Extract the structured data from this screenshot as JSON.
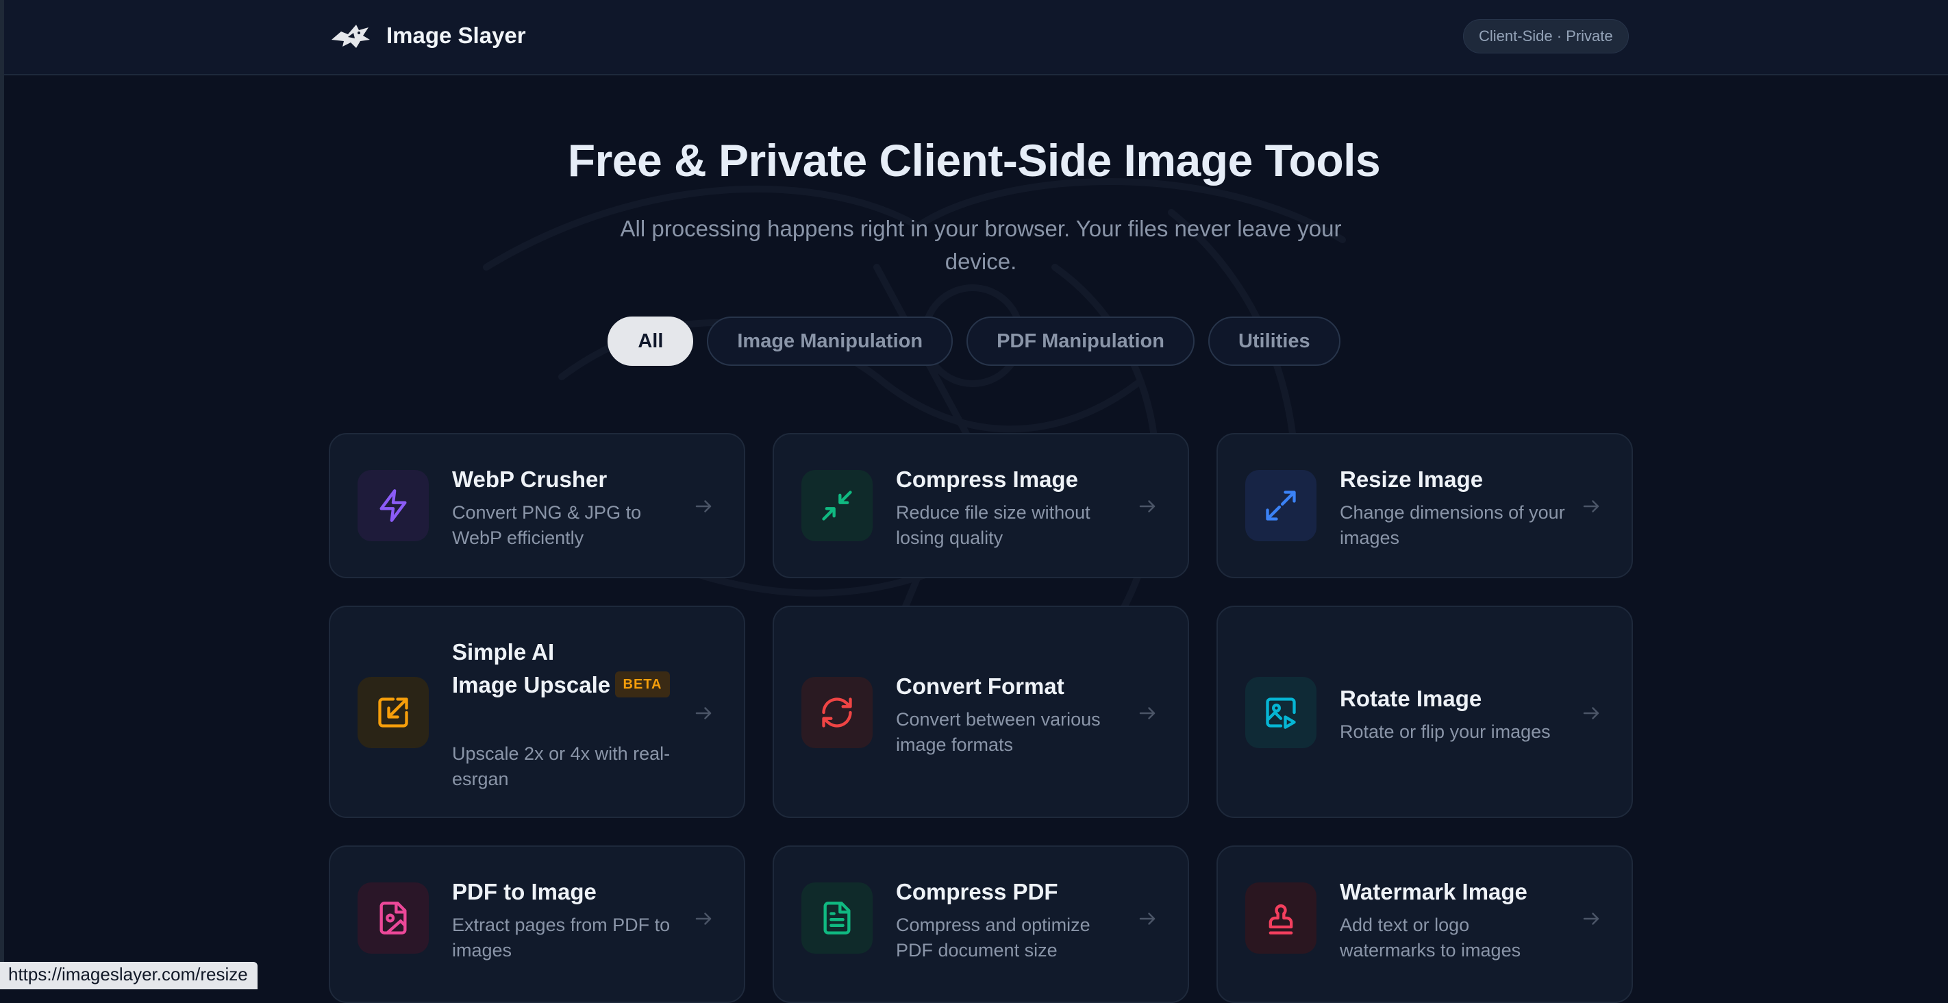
{
  "header": {
    "brand": "Image Slayer",
    "badge": "Client-Side · Private"
  },
  "hero": {
    "title": "Free & Private Client-Side Image Tools",
    "subtitle": "All processing happens right in your browser. Your files never leave your device."
  },
  "filters": [
    {
      "label": "All",
      "active": true
    },
    {
      "label": "Image Manipulation",
      "active": false
    },
    {
      "label": "PDF Manipulation",
      "active": false
    },
    {
      "label": "Utilities",
      "active": false
    }
  ],
  "tools": [
    {
      "title": "WebP Crusher",
      "description": "Convert PNG & JPG to WebP efficiently",
      "icon": "lightning-icon",
      "color": "#8b5cf6"
    },
    {
      "title": "Compress Image",
      "description": "Reduce file size without losing quality",
      "icon": "minimize-arrows-icon",
      "color": "#10b981"
    },
    {
      "title": "Resize Image",
      "description": "Change dimensions of your images",
      "icon": "expand-arrows-icon",
      "color": "#3b82f6"
    },
    {
      "title": "Simple AI Image Upscale",
      "badge": "BETA",
      "description": "Upscale 2x or 4x with real-esrgan",
      "icon": "upscale-icon",
      "color": "#f59e0b"
    },
    {
      "title": "Convert Format",
      "description": "Convert between various image formats",
      "icon": "refresh-icon",
      "color": "#ef4444"
    },
    {
      "title": "Rotate Image",
      "description": "Rotate or flip your images",
      "icon": "image-play-icon",
      "color": "#06b6d4"
    },
    {
      "title": "PDF to Image",
      "description": "Extract pages from PDF to images",
      "icon": "file-image-icon",
      "color": "#ec4899"
    },
    {
      "title": "Compress PDF",
      "description": "Compress and optimize PDF document size",
      "icon": "file-text-icon",
      "color": "#10b981"
    },
    {
      "title": "Watermark Image",
      "description": "Add text or logo watermarks to images",
      "icon": "stamp-icon",
      "color": "#f43f5e"
    }
  ],
  "status_url": "https://imageslayer.com/resize"
}
